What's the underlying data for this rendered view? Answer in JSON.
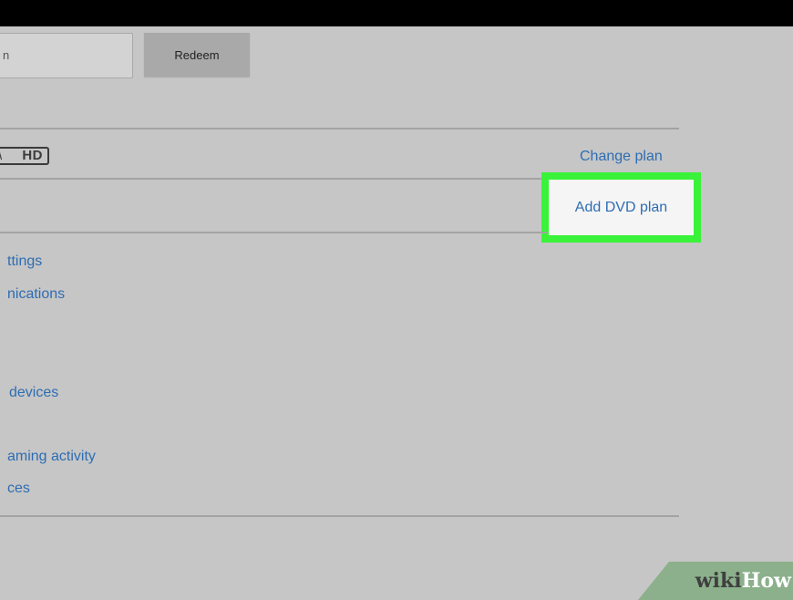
{
  "header": {
    "background": "#000000"
  },
  "gift_card": {
    "input_value": "n",
    "redeem_label": "Redeem"
  },
  "plan": {
    "quality_badge": "HD",
    "change_plan_label": "Change plan",
    "add_dvd_plan_label": "Add DVD plan",
    "highlight_color": "#3af23a"
  },
  "settings_links": [
    "ttings",
    "nications",
    "devices",
    "aming activity",
    "ces"
  ],
  "watermark": {
    "part1": "wiki",
    "part2": "How"
  }
}
